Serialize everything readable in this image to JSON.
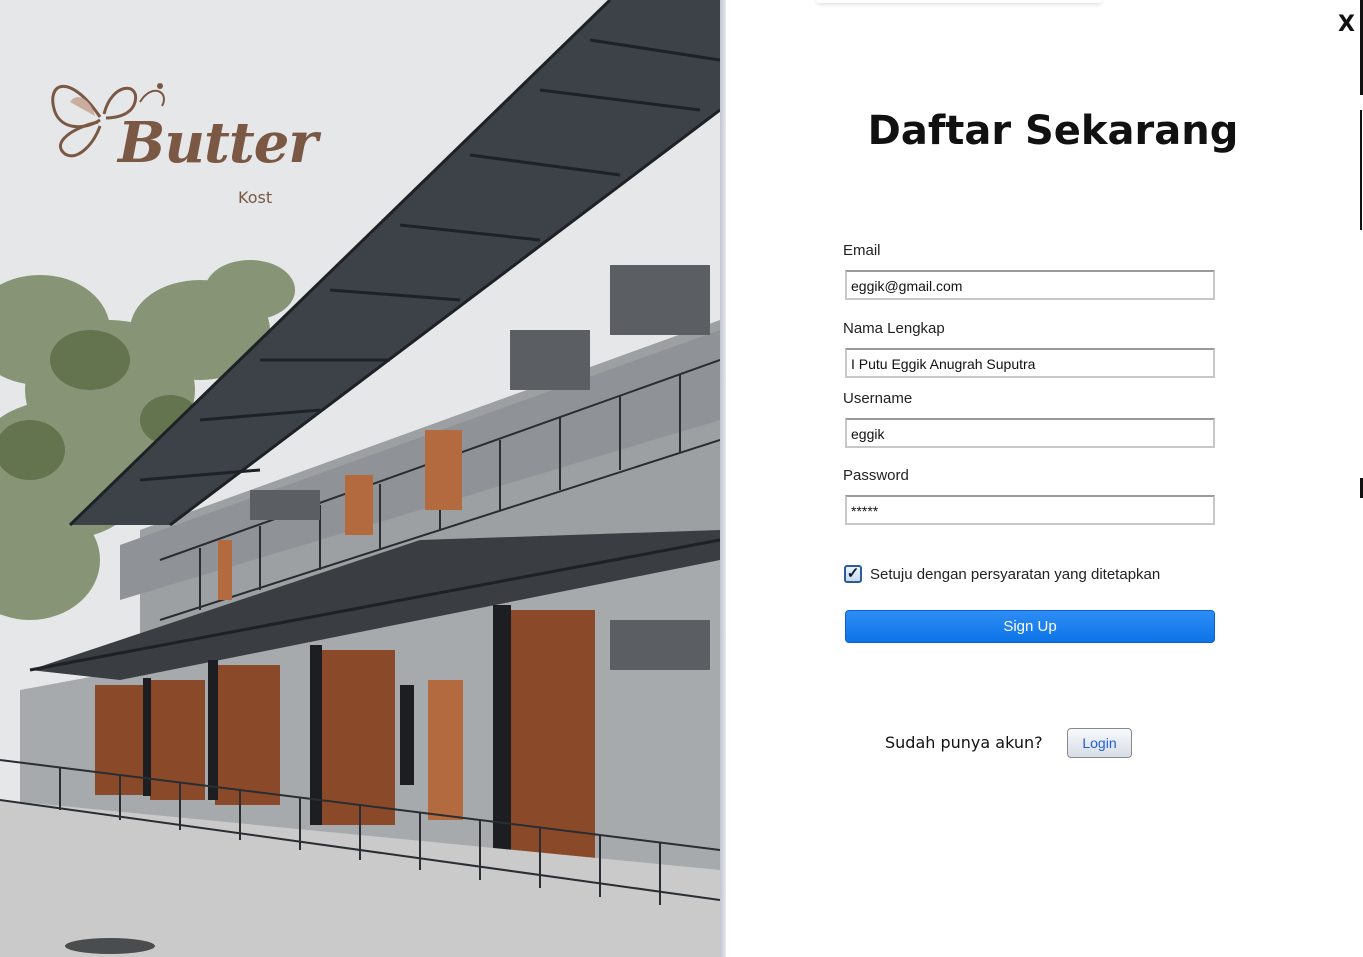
{
  "window": {
    "close_label": "X"
  },
  "brand": {
    "logo_word": "Butter",
    "logo_sub": "Kost"
  },
  "form": {
    "title": "Daftar Sekarang",
    "email": {
      "label": "Email",
      "value": "eggik@gmail.com"
    },
    "full_name": {
      "label": "Nama Lengkap",
      "value": "I Putu Eggik Anugrah Suputra"
    },
    "username": {
      "label": "Username",
      "value": "eggik"
    },
    "password": {
      "label": "Password",
      "value": "*****"
    },
    "agree": {
      "checked": true,
      "label": "Setuju dengan persyaratan yang ditetapkan",
      "mark": "✓"
    },
    "signup_label": "Sign Up",
    "login_prompt": "Sudah punya akun?",
    "login_label": "Login"
  },
  "colors": {
    "primary_button": "#1a7ef0",
    "login_text": "#1f5ed0",
    "logo": "#7a5844"
  }
}
